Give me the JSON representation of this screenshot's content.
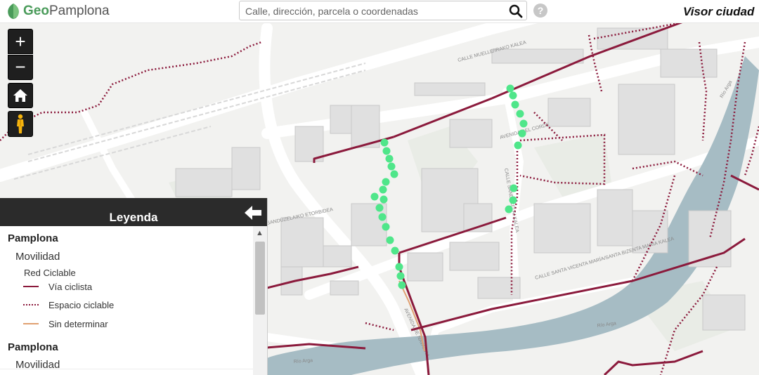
{
  "header": {
    "logo_prefix": "Geo",
    "logo_name": "Pamplona",
    "search_placeholder": "Calle, dirección, parcela o coordenadas",
    "help_label": "?",
    "visor_title": "Visor ciudad"
  },
  "controls": {
    "zoom_in": "+",
    "zoom_out": "−"
  },
  "legend": {
    "title": "Leyenda",
    "sections": [
      {
        "city": "Pamplona",
        "category": "Movilidad",
        "group": "Red Ciclable",
        "items": [
          {
            "label": "Vía ciclista",
            "style": "solid",
            "color": "#8b1a3c"
          },
          {
            "label": "Espacio ciclable",
            "style": "dotted",
            "color": "#8b1a3c"
          },
          {
            "label": "Sin determinar",
            "style": "solid",
            "color": "#e0a070"
          }
        ]
      },
      {
        "city": "Pamplona",
        "category": "Movilidad"
      }
    ]
  },
  "map": {
    "street_labels": [
      "CALLE MUELLE/IRAKO KALEA",
      "AVENIDA DEL CORDE",
      "CALLE SANDUZELAI KALEA",
      "SANDUZELAIKO ETORBIDEA",
      "AVENIDA DE NAVARRA",
      "CALLE SANTA VICENTA MARÍA/SANTA BIZENTA MARIA KALEA",
      "Río Arga"
    ]
  },
  "colors": {
    "accent": "#4a9b5a",
    "cycle_lane": "#8b1a3c",
    "undetermined": "#e0a070",
    "proposed_dots": "#4fe68a",
    "river": "#a6bcc4"
  }
}
